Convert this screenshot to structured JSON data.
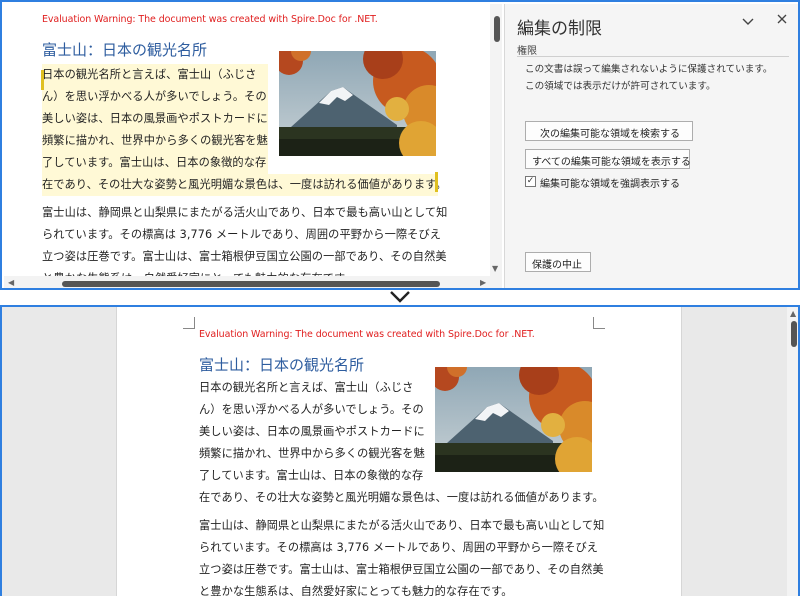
{
  "document": {
    "warning": "Evaluation Warning: The document was created with Spire.Doc for .NET.",
    "heading": "富士山：日本の観光名所",
    "para1_lines": [
      "日本の観光名所と言えば、富士山（ふじさ",
      "ん）を思い浮かべる人が多いでしょう。その",
      "美しい姿は、日本の風景画やポストカードに",
      "頻繁に描かれ、世界中から多くの観光客を魅",
      "了しています。富士山は、日本の象徴的な存",
      "在であり、その壮大な姿勢と風光明媚な景色は、一度は訪れる価値があります。"
    ],
    "para2_lines": [
      "富士山は、静岡県と山梨県にまたがる活火山であり、日本で最も高い山として知",
      "られています。その標高は 3,776 メートルであり、周囲の平野から一際そびえ",
      "立つ姿は圧巻です。富士山は、富士箱根伊豆国立公園の一部であり、その自然美",
      "と豊かな生態系は、自然愛好家にとっても魅力的な存在です。"
    ]
  },
  "restrict_pane": {
    "title": "編集の制限",
    "section": "権限",
    "message_lines": [
      "この文書は誤って編集されないように保護されています。",
      "この領域では表示だけが許可されています。"
    ],
    "find_next_label": "次の編集可能な領域を検索する",
    "show_all_label": "すべての編集可能な領域を表示する",
    "highlight_label": "編集可能な領域を強調表示する",
    "highlight_checked": true,
    "stop_label": "保護の中止"
  },
  "colors": {
    "accent": "#2f7fe0",
    "heading": "#2e5d9f",
    "warning": "#e02020",
    "highlight": "#fff9d6"
  }
}
